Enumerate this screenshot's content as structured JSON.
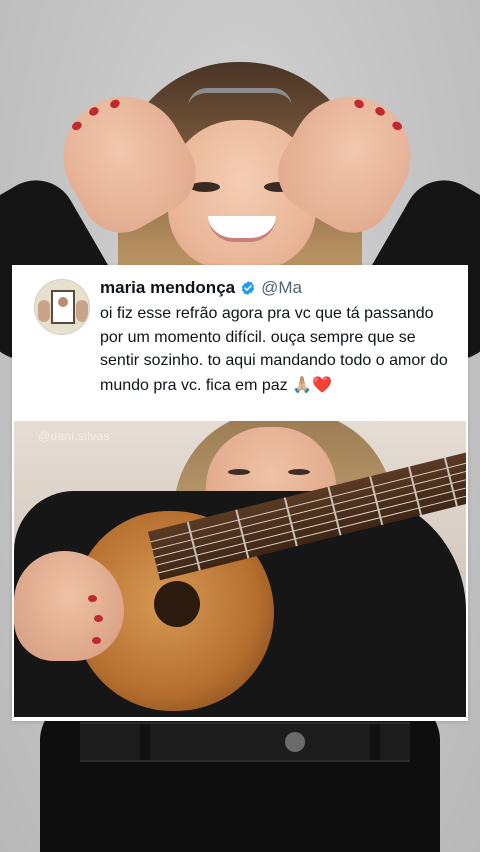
{
  "tweet": {
    "display_name": "maria mendonça",
    "handle": "@Ma",
    "verified_icon": "verified-badge-icon",
    "text": "oi fiz esse refrão agora pra vc que tá passando por um momento difícil. ouça sempre que se sentir sozinho. to aqui mandando todo o amor do mundo pra vc. fica em paz",
    "emoji_pray": "🙏🏼",
    "emoji_heart": "❤️"
  },
  "video": {
    "watermark": "@dani.silvas"
  },
  "colors": {
    "verified_blue": "#1d9bf0",
    "heart_red": "#d0121b",
    "text_dark": "#0f1419",
    "handle_gray": "#536471"
  }
}
